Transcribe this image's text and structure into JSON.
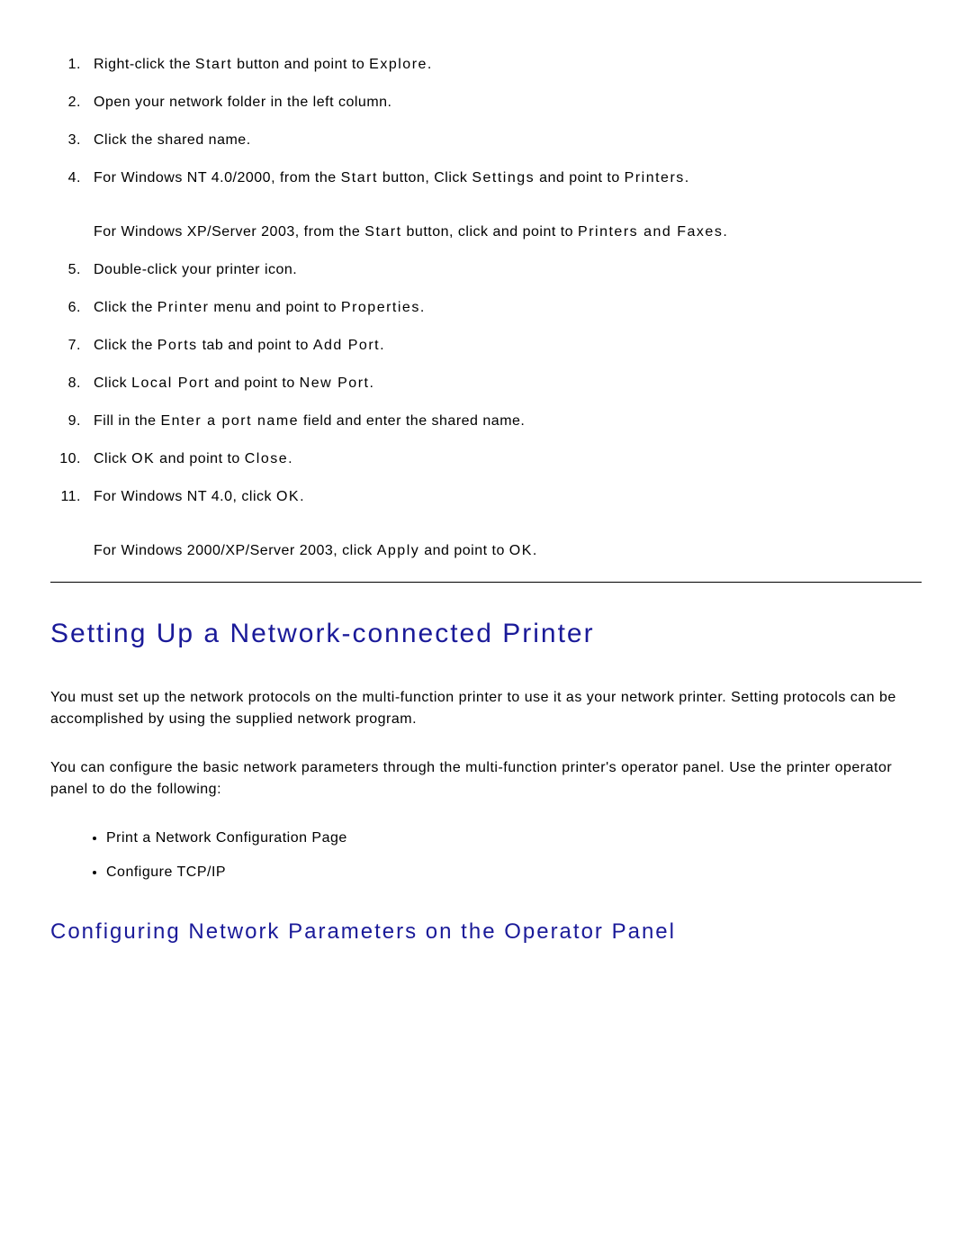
{
  "steps": [
    {
      "n": "1.",
      "html": "Right-click the <span class='b'>Start</span> button and point to <span class='b'>Explore</span>."
    },
    {
      "n": "2.",
      "html": "Open your network folder in the left column."
    },
    {
      "n": "3.",
      "html": "Click the shared name."
    },
    {
      "n": "4.",
      "html": "For Windows NT 4.0/2000, from the <span class='b'>Start</span> button, Click <span class='b'>Settings</span> and point to <span class='b'>Printers</span>.",
      "sub": "For Windows XP/Server 2003, from the <span class='b'>Start</span> button, click and point to <span class='b'>Printers and Faxes</span>."
    },
    {
      "n": "5.",
      "html": "Double-click your printer icon."
    },
    {
      "n": "6.",
      "html": "Click the <span class='b'>Printer</span> menu and point to <span class='b'>Properties</span>."
    },
    {
      "n": "7.",
      "html": "Click the <span class='b'>Ports</span> tab and point to <span class='b'>Add Port</span>."
    },
    {
      "n": "8.",
      "html": "Click <span class='b'>Local Port</span> and point to <span class='b'>New Port</span>."
    },
    {
      "n": "9.",
      "html": "Fill in the <span class='b'>Enter a port name</span> field and enter the shared name."
    },
    {
      "n": "10.",
      "html": "Click <span class='b'>OK</span> and point to <span class='b'>Close</span>."
    },
    {
      "n": "11.",
      "html": "For Windows NT 4.0, click <span class='b'>OK</span>.",
      "sub": "For Windows 2000/XP/Server 2003, click <span class='b'>Apply</span> and point to <span class='b'>OK</span>."
    }
  ],
  "section_title": "Setting Up a Network-connected Printer",
  "para1": "You must set up the network protocols on the multi-function printer to use it as your network printer. Setting protocols can be accomplished by using the supplied network program.",
  "para2": "You can configure the basic network parameters through the multi-function printer's operator panel. Use the printer operator panel to do the following:",
  "bullets": [
    "Print a Network Configuration Page",
    "Configure TCP/IP"
  ],
  "subsection_title": "Configuring Network Parameters on the Operator Panel"
}
